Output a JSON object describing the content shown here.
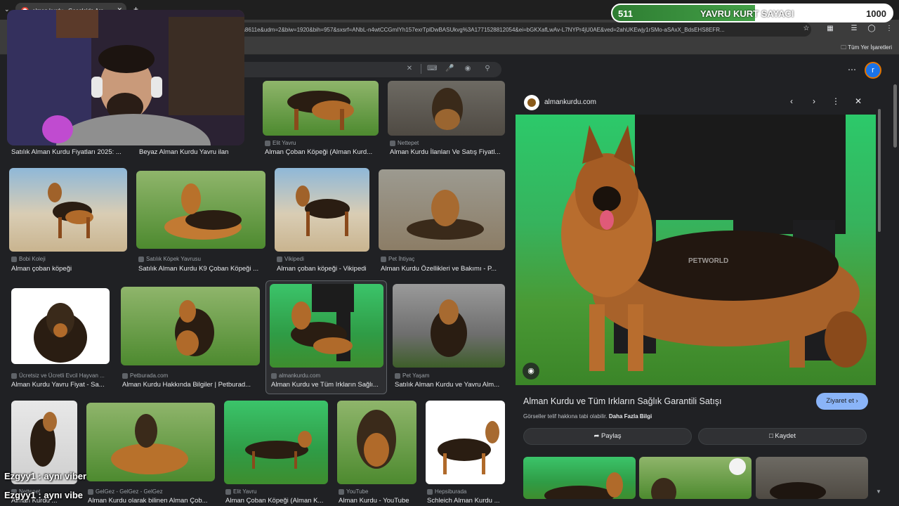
{
  "browser": {
    "tab_title": "alman kurdu - Google'da Ara",
    "url": "aa8611e&udm=2&biw=1920&bih=957&sxsrf=ANbL-n4wtCCGmIYh157exrTplDwBASUkvg%3A1771528812054&ei=bGKXafLwAv-L7NYPr4jU0AE&ved=2ahUKEwjy1rSMo-aSAxX_BdsEHS8EFR...",
    "bookmarks_label": "Tüm Yer İşaretleri"
  },
  "account": {
    "initial": "r"
  },
  "grid": {
    "row1": [
      {
        "source": "",
        "title": "Satılık Alman Kurdu Fiyatları 2025: ..."
      },
      {
        "source": "",
        "title": "Beyaz Alman Kurdu Yavru ilan"
      },
      {
        "source": "Elit Yavru",
        "title": "Alman Çoban Köpeği (Alman Kurd..."
      },
      {
        "source": "Nettepet",
        "title": "Alman Kurdu İlanları Ve Satış Fiyatl..."
      }
    ],
    "row2": [
      {
        "source": "Bobi Koleji",
        "title": "Alman çoban köpeği"
      },
      {
        "source": "Satılık Köpek Yavrusu",
        "title": "Satılık Alman Kurdu K9 Çoban Köpeği ..."
      },
      {
        "source": "Vikipedi",
        "title": "Alman çoban köpeği - Vikipedi"
      },
      {
        "source": "Pet İhtiyaç",
        "title": "Alman Kurdu Özellikleri ve Bakımı - P..."
      }
    ],
    "row3": [
      {
        "source": "Ücretsiz ve Ücretli Evcil Hayvan ...",
        "title": "Alman Kurdu Yavru Fiyat - Sa..."
      },
      {
        "source": "Petburada.com",
        "title": "Alman Kurdu Hakkında Bilgiler | Petburad..."
      },
      {
        "source": "almankurdu.com",
        "title": "Alman Kurdu ve Tüm Irkların Sağlı..."
      },
      {
        "source": "Pet Yaşam",
        "title": "Satılık Alman Kurdu ve Yavru Alm..."
      }
    ],
    "row4": [
      {
        "source": "Nettepet",
        "title": "Alman Kurdu ..."
      },
      {
        "source": "GelGez - GelGez - GelGez",
        "title": "Alman Kurdu olarak bilinen Alman Çob..."
      },
      {
        "source": "Elit Yavru",
        "title": "Alman Çoban Köpeği (Alman K..."
      },
      {
        "source": "YouTube",
        "title": "Alman Kurdu - YouTube"
      },
      {
        "source": "Hepsiburada",
        "title": "Schleich Alman Kurdu ..."
      }
    ]
  },
  "panel": {
    "site": "almankurdu.com",
    "watermark": "PETWORLD",
    "title": "Alman Kurdu ve Tüm Irkların Sağlık Garantili Satışı",
    "visit_label": "Ziyaret et",
    "note": "Görseller telif hakkına tabi olabilir.",
    "note_link": "Daha Fazla Bilgi",
    "share_label": "Paylaş",
    "save_label": "Kaydet"
  },
  "overlay": {
    "counter_current": "511",
    "counter_label": "YAVRU KURT SAYACI",
    "counter_max": "1000",
    "counter_fraction": 0.511,
    "chat": [
      "Ezgyy1 : aynı viber",
      "Ezgyy1 : aynı vibe"
    ]
  },
  "colors": {
    "accent": "#8ab4f8",
    "counter_green": "#43a047",
    "background": "#202124"
  }
}
